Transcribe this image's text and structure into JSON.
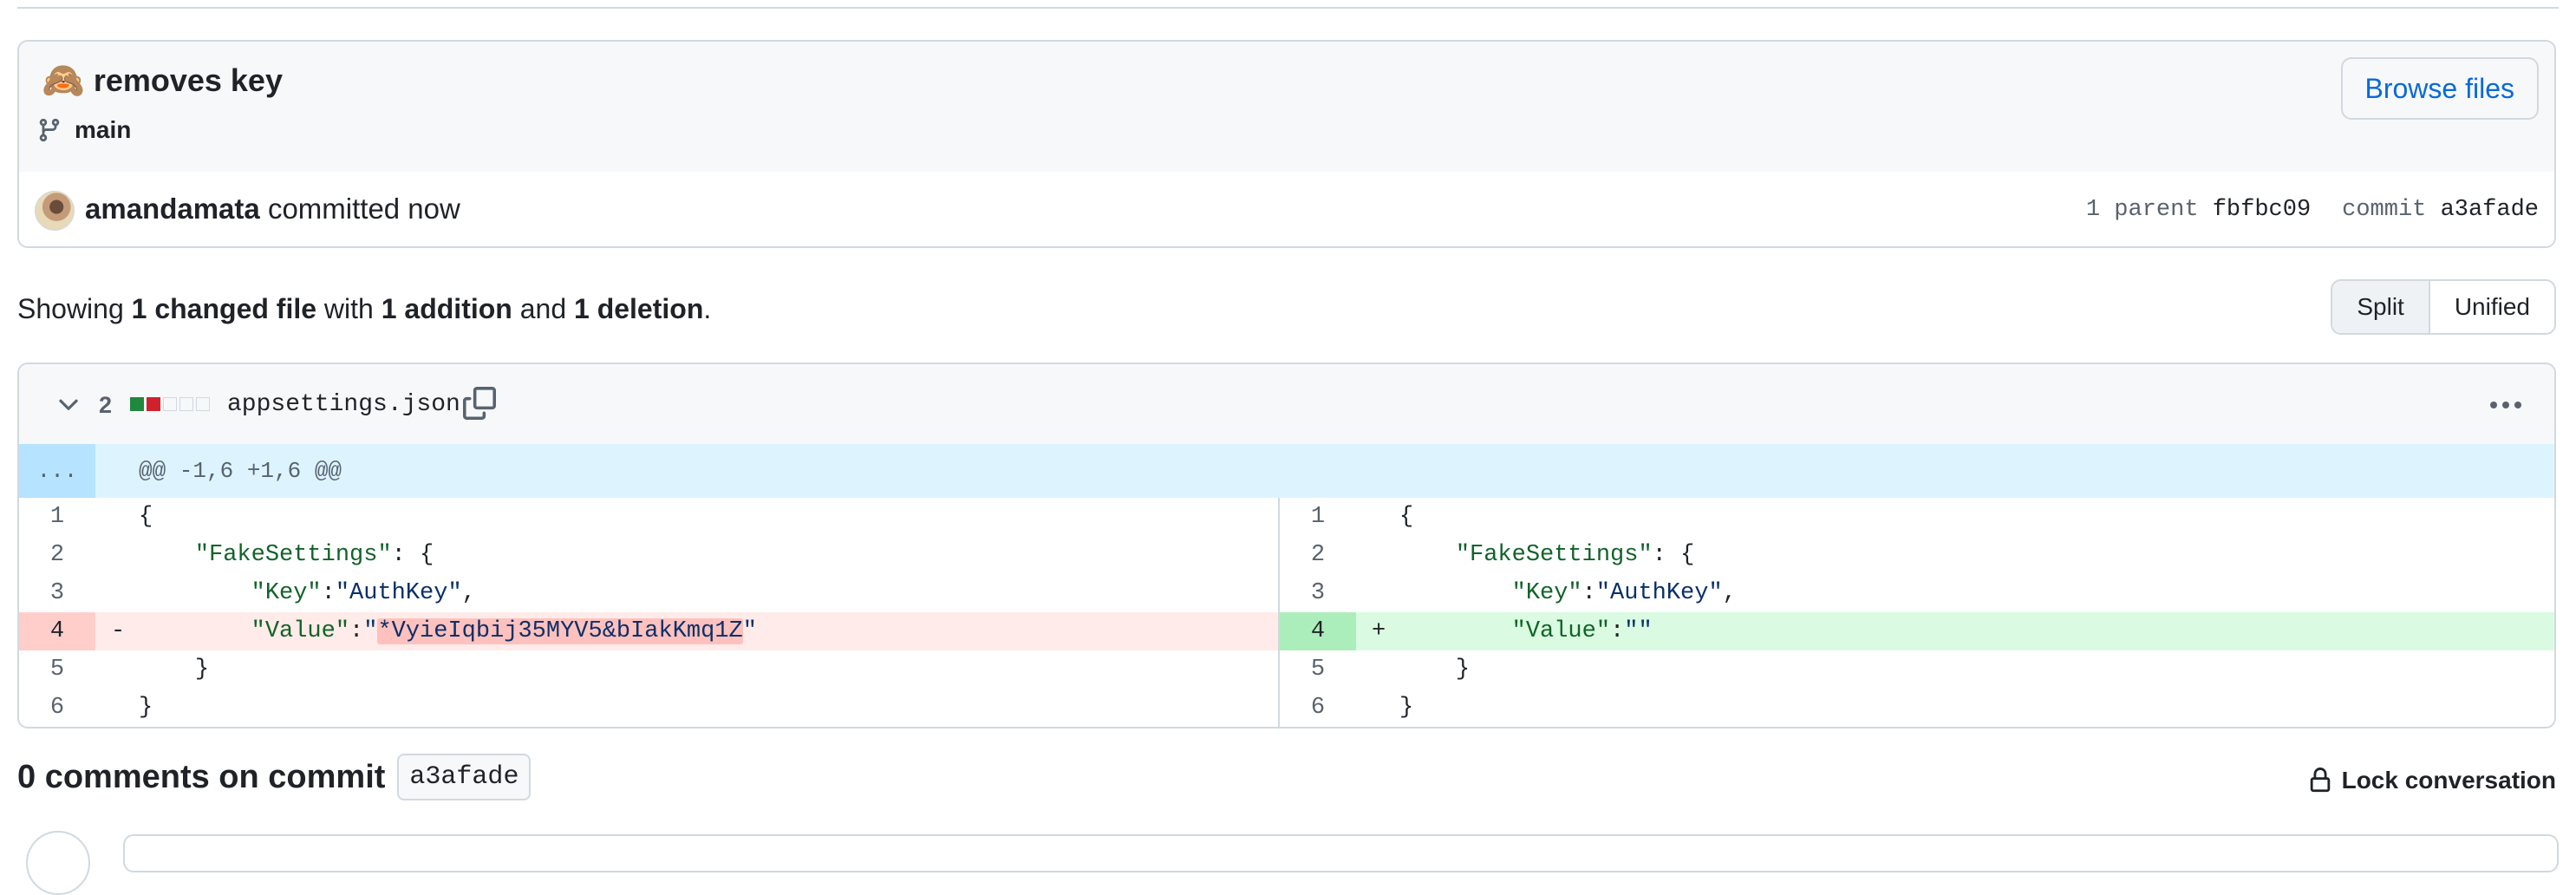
{
  "commit": {
    "emoji": "🙈",
    "title": "removes key",
    "branch": "main",
    "browse_label": "Browse files",
    "author": "amandamata",
    "verb": "committed now",
    "parent_label": "1 parent",
    "parent_sha": "fbfbc09",
    "commit_label": "commit",
    "commit_sha": "a3afade"
  },
  "summary": {
    "prefix": "Showing ",
    "changed": "1 changed file",
    "mid1": " with ",
    "additions": "1 addition",
    "mid2": " and ",
    "deletions": "1 deletion",
    "suffix": "."
  },
  "view_toggle": {
    "split": "Split",
    "unified": "Unified"
  },
  "file": {
    "change_count": "2",
    "name": "appsettings.json",
    "hunk_expand": "...",
    "hunk_header": "@@ -1,6 +1,6 @@"
  },
  "diff": {
    "left": [
      {
        "ln": "1",
        "sign": "",
        "kind": "ctx",
        "code": "{"
      },
      {
        "ln": "2",
        "sign": "",
        "kind": "ctx",
        "code": "    \"FakeSettings\": {"
      },
      {
        "ln": "3",
        "sign": "",
        "kind": "ctx",
        "code": "        \"Key\":\"AuthKey\","
      },
      {
        "ln": "4",
        "sign": "-",
        "kind": "del",
        "code": "        \"Value\":\"*VyieIqbij35MYV5&bIakKmq1Z\""
      },
      {
        "ln": "5",
        "sign": "",
        "kind": "ctx",
        "code": "    }"
      },
      {
        "ln": "6",
        "sign": "",
        "kind": "ctx",
        "code": "}"
      }
    ],
    "right": [
      {
        "ln": "1",
        "sign": "",
        "kind": "ctx",
        "code": "{"
      },
      {
        "ln": "2",
        "sign": "",
        "kind": "ctx",
        "code": "    \"FakeSettings\": {"
      },
      {
        "ln": "3",
        "sign": "",
        "kind": "ctx",
        "code": "        \"Key\":\"AuthKey\","
      },
      {
        "ln": "4",
        "sign": "+",
        "kind": "add",
        "code": "        \"Value\":\"\""
      },
      {
        "ln": "5",
        "sign": "",
        "kind": "ctx",
        "code": "    }"
      },
      {
        "ln": "6",
        "sign": "",
        "kind": "ctx",
        "code": "}"
      }
    ],
    "deleted_value": "*VyieIqbij35MYV5&bIakKmq1Z"
  },
  "comments": {
    "title": "0 comments on commit",
    "sha": "a3afade",
    "lock_label": "Lock conversation"
  },
  "colors": {
    "accent": "#0969da",
    "addition": "#1f883d",
    "deletion": "#cf222e",
    "hunk_bg": "#ddf4ff"
  },
  "icons": {
    "branch": "git-branch-icon",
    "chevron": "chevron-down-icon",
    "copy": "copy-icon",
    "kebab": "kebab-horizontal-icon",
    "lock": "lock-icon"
  }
}
